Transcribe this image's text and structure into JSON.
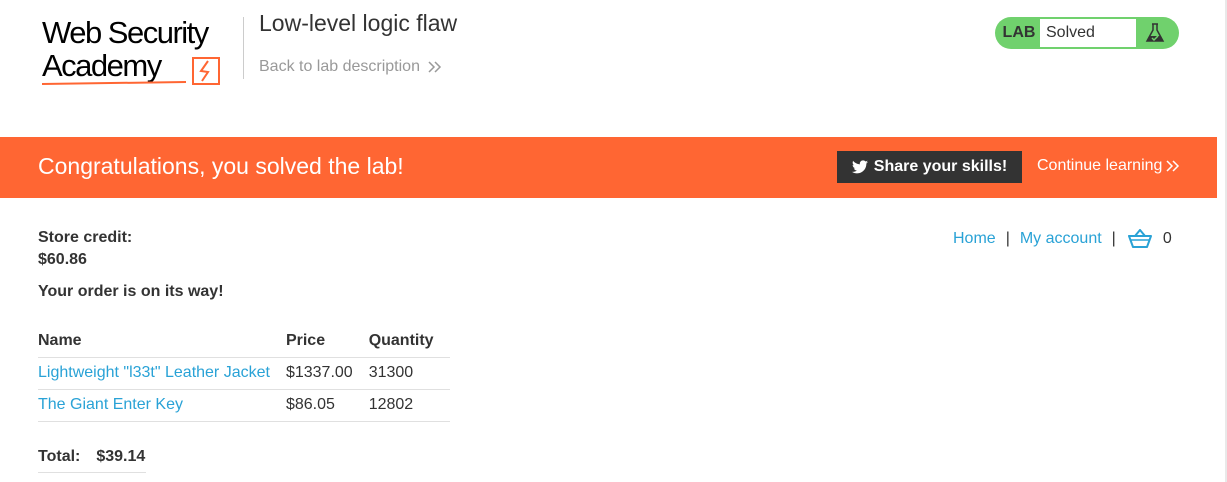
{
  "header": {
    "logo_line1": "Web Security",
    "logo_line2": "Academy",
    "lab_title": "Low-level logic flaw",
    "back_link": "Back to lab description",
    "lab_status_label": "LAB",
    "lab_status_value": "Solved"
  },
  "banner": {
    "message": "Congratulations, you solved the lab!",
    "share_button": "Share your skills!",
    "continue_link": "Continue learning"
  },
  "nav": {
    "home": "Home",
    "separator": "|",
    "my_account": "My account",
    "cart_count": "0"
  },
  "account": {
    "credit_label": "Store credit:",
    "credit_value": "$60.86",
    "order_message": "Your order is on its way!"
  },
  "cart_table": {
    "headers": [
      "Name",
      "Price",
      "Quantity"
    ],
    "rows": [
      {
        "name": "Lightweight \"l33t\" Leather Jacket",
        "price": "$1337.00",
        "quantity": "31300"
      },
      {
        "name": "The Giant Enter Key",
        "price": "$86.05",
        "quantity": "12802"
      }
    ]
  },
  "total": {
    "label": "Total:",
    "value": "$39.14"
  },
  "colors": {
    "brand_orange": "#ff6633",
    "link_blue": "#29a2d6",
    "solved_green": "#70d16d",
    "dark": "#333333"
  },
  "icons": [
    "academy-logo-icon",
    "double-chevron-right-icon",
    "flask-icon",
    "twitter-icon",
    "cart-icon"
  ]
}
